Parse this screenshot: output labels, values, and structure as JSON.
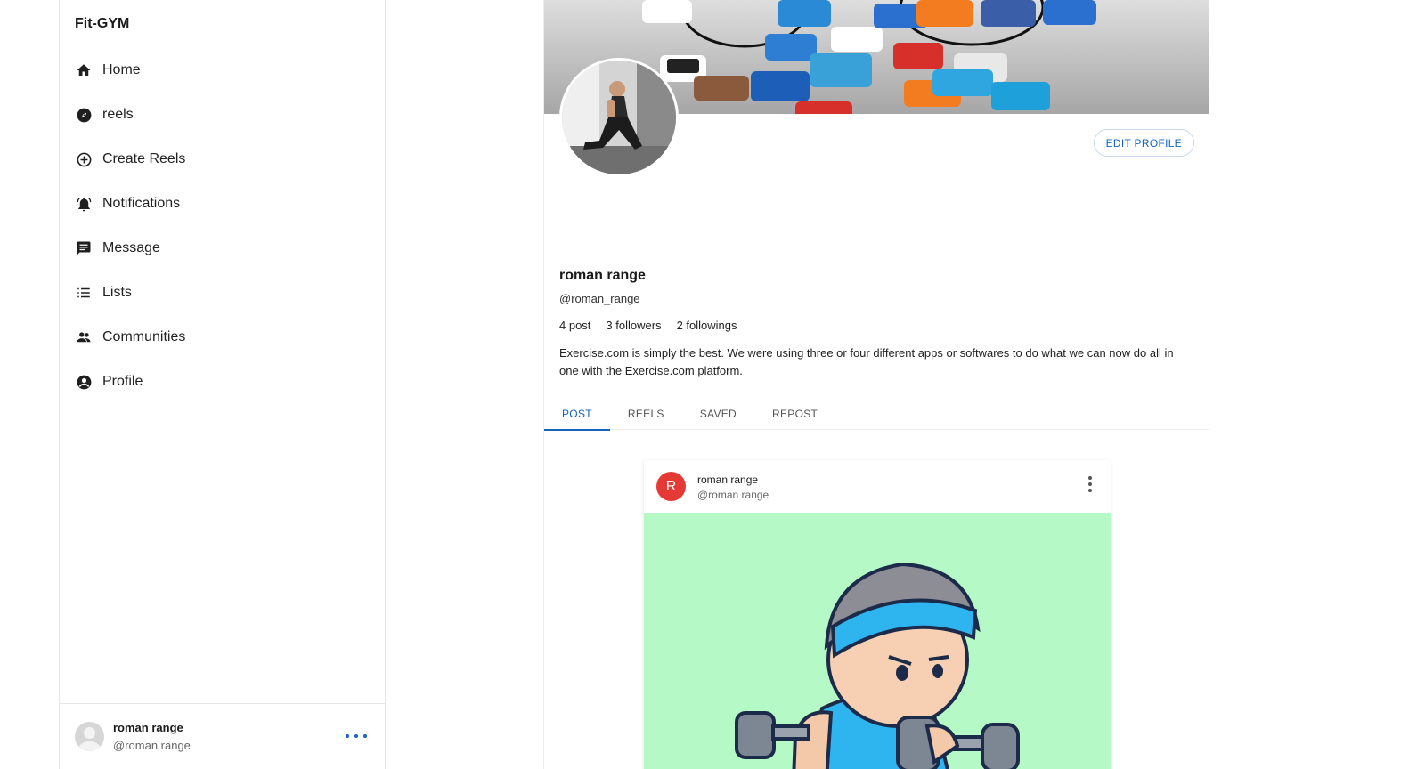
{
  "app": {
    "brand": "Fit-GYM"
  },
  "sidebar": {
    "items": [
      {
        "label": "Home",
        "icon": "home-icon"
      },
      {
        "label": "reels",
        "icon": "compass-icon"
      },
      {
        "label": "Create Reels",
        "icon": "add-circle-icon"
      },
      {
        "label": "Notifications",
        "icon": "bell-icon"
      },
      {
        "label": "Message",
        "icon": "message-icon"
      },
      {
        "label": "Lists",
        "icon": "list-icon"
      },
      {
        "label": "Communities",
        "icon": "people-icon"
      },
      {
        "label": "Profile",
        "icon": "account-circle-icon"
      }
    ],
    "footer": {
      "name": "roman range",
      "handle": "@roman range",
      "more_icon": "more-horizontal-icon"
    }
  },
  "profile": {
    "edit_label": "EDIT PROFILE",
    "name": "roman range",
    "handle": "@roman_range",
    "stats": {
      "posts": "4 post",
      "followers": "3 followers",
      "followings": "2 followings"
    },
    "bio": "Exercise.com is simply the best. We were using three or four different apps or softwares to do what we can now do all in one with the Exercise.com platform.",
    "tabs": [
      {
        "label": "POST",
        "active": true
      },
      {
        "label": "REELS",
        "active": false
      },
      {
        "label": "SAVED",
        "active": false
      },
      {
        "label": "REPOST",
        "active": false
      }
    ]
  },
  "post": {
    "avatar_letter": "R",
    "name": "roman range",
    "handle": "@roman range",
    "avatar_color": "#e53935",
    "image_bg": "#b5f9c6"
  },
  "colors": {
    "accent": "#1565c0"
  }
}
